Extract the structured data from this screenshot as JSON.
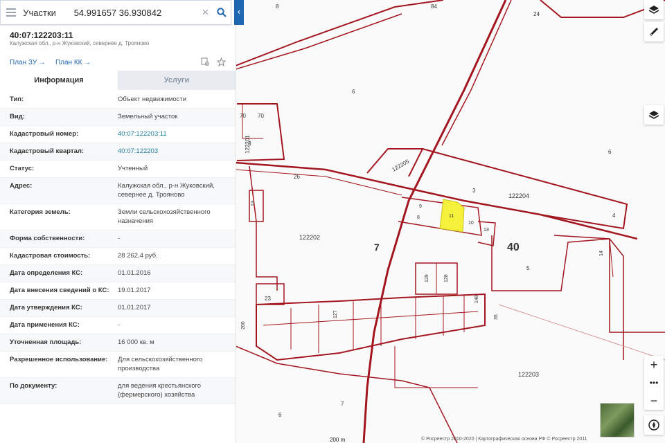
{
  "search": {
    "category": "Участки",
    "value": "54.991657 36.930842"
  },
  "object": {
    "cadastral_title": "40:07:122203:11",
    "address_short": "Калужская обл., р-н Жуковский, севернее д. Трояново"
  },
  "plans": [
    "План ЗУ",
    "План КК"
  ],
  "tabs": [
    {
      "label": "Информация",
      "active": true
    },
    {
      "label": "Услуги",
      "active": false
    }
  ],
  "info_rows": [
    {
      "key": "Тип:",
      "value": "Объект недвижимости"
    },
    {
      "key": "Вид:",
      "value": "Земельный участок"
    },
    {
      "key": "Кадастровый номер:",
      "value": "40:07:122203:11",
      "link": true
    },
    {
      "key": "Кадастровый квартал:",
      "value": "40:07:122203",
      "link": true
    },
    {
      "key": "Статус:",
      "value": "Учтенный"
    },
    {
      "key": "Адрес:",
      "value": "Калужская обл., р-н Жуковский, севернее д. Трояново"
    },
    {
      "key": "Категория земель:",
      "value": "Земли сельскохозяйственного назначения"
    },
    {
      "key": "Форма собственности:",
      "value": "-"
    },
    {
      "key": "Кадастровая стоимость:",
      "value": "28 262,4 руб."
    },
    {
      "key": "Дата определения КС:",
      "value": "01.01.2016"
    },
    {
      "key": "Дата внесения сведений о КС:",
      "value": "19.01.2017"
    },
    {
      "key": "Дата утверждения КС:",
      "value": "01.01.2017"
    },
    {
      "key": "Дата применения КС:",
      "value": "-"
    },
    {
      "key": "Уточненная площадь:",
      "value": "16 000 кв. м"
    },
    {
      "key": "Разрешенное использование:",
      "value": "Для сельскохозяйственного производства"
    },
    {
      "key": "По документу:",
      "value": "для ведения крестьянского (фермерского) хозяйства"
    }
  ],
  "map": {
    "labels": {
      "l8": "8",
      "l84": "84",
      "l24": "24",
      "l6a": "6",
      "l70a": "70",
      "l70b": "70",
      "l122201": "122201",
      "l3a": "3",
      "l122205": "122205",
      "l26": "26",
      "l6b": "6",
      "l3b": "3",
      "l122204": "122204",
      "l4": "4",
      "l13a": "13",
      "l9": "9",
      "l8b": "8",
      "l11": "11",
      "l10": "10",
      "l13b": "13",
      "l122202": "122202",
      "l7": "7",
      "l40": "40",
      "l5": "5",
      "l14": "14",
      "l129": "129",
      "l128": "128",
      "l23": "23",
      "l200": "200",
      "l127": "127",
      "l148": "148",
      "l35": "35",
      "l122203": "122203",
      "l7b": "7",
      "l6c": "6"
    },
    "scale": "200 m",
    "copyright": "© Росреестр 2010-2020 | Картографическая основа РФ © Росреестр 2011",
    "selected_parcel_color": "#f5f03a",
    "boundary_color": "#a3161f"
  }
}
